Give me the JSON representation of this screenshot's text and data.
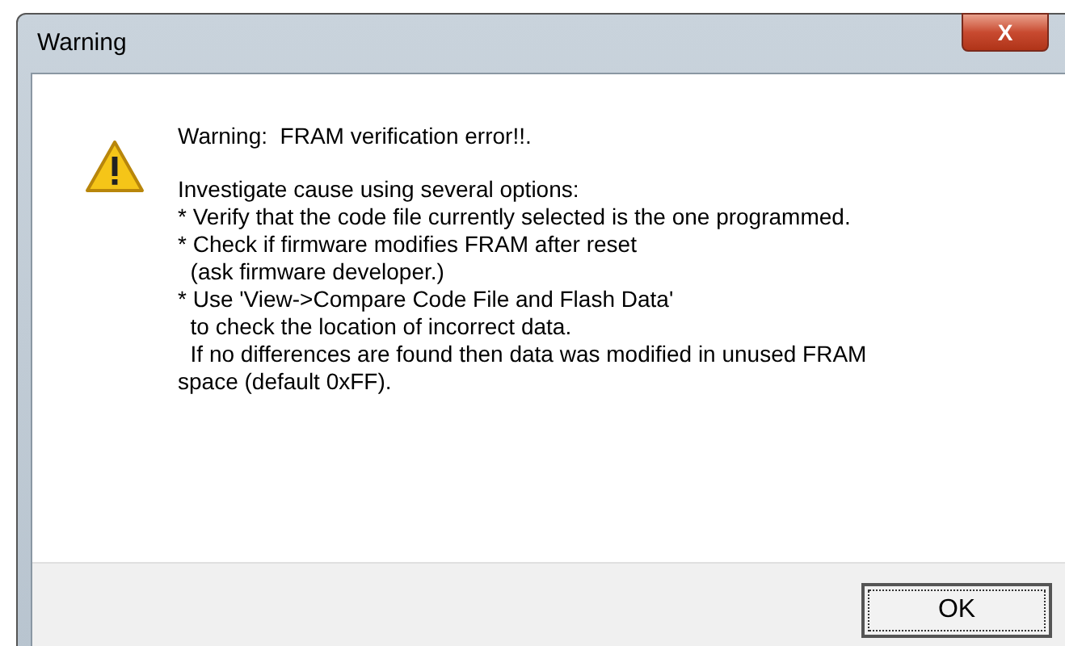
{
  "window": {
    "title": "Warning",
    "close": "X"
  },
  "message": {
    "heading": "Warning:  FRAM verification error!!.",
    "lines": [
      "Investigate cause using several options:",
      "* Verify that the code file currently selected is the one programmed.",
      "* Check if firmware modifies FRAM after reset",
      "  (ask firmware developer.)",
      "* Use 'View->Compare Code File and Flash Data'",
      "  to check the location of incorrect data.",
      "  If no differences are found then data was modified in unused FRAM",
      "space (default 0xFF)."
    ]
  },
  "buttons": [
    {
      "label": "OK",
      "selected": true
    }
  ]
}
